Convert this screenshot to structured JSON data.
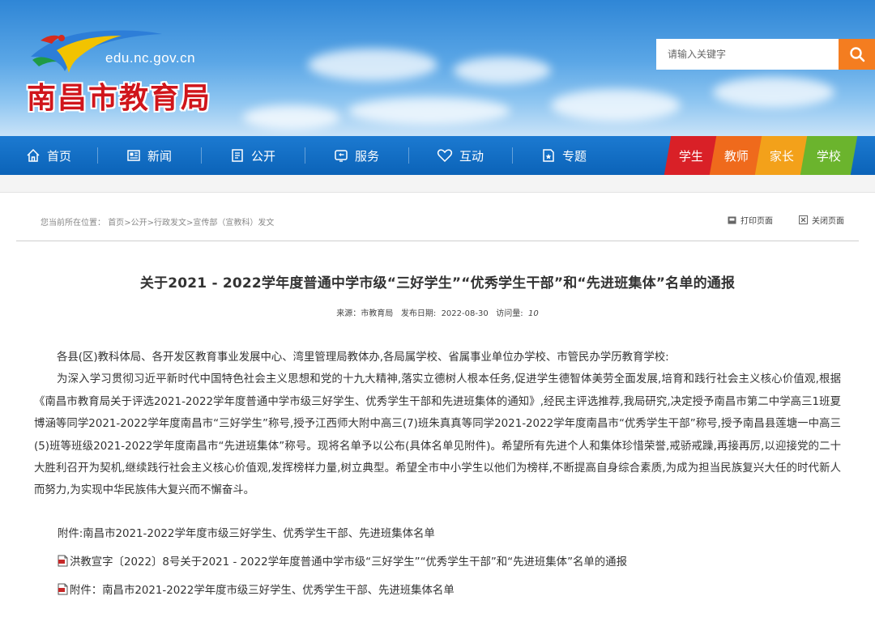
{
  "header": {
    "domain": "edu.nc.gov.cn",
    "site_title": "南昌市教育局"
  },
  "search": {
    "placeholder": "请输入关键字",
    "icon": "search-icon"
  },
  "nav": {
    "items": [
      {
        "label": "首页",
        "icon": "home-icon"
      },
      {
        "label": "新闻",
        "icon": "news-icon"
      },
      {
        "label": "公开",
        "icon": "document-icon"
      },
      {
        "label": "服务",
        "icon": "service-icon"
      },
      {
        "label": "互动",
        "icon": "heart-icon"
      },
      {
        "label": "专题",
        "icon": "topic-icon"
      }
    ],
    "roles": [
      "学生",
      "教师",
      "家长",
      "学校"
    ]
  },
  "colors": {
    "nav_blue": "#0b63b8",
    "search_orange": "#f47d20",
    "role_student": "#d92027",
    "role_teacher": "#ef6a1c",
    "role_parent": "#f3a11a",
    "role_school": "#6bb42d",
    "title_red": "#d0151b"
  },
  "breadcrumb": {
    "prefix": "您当前所在位置：",
    "items": [
      "首页",
      "公开",
      "行政发文",
      "宣传部（宣教科）发文"
    ]
  },
  "tools": {
    "print": "打印页面",
    "close": "关闭页面"
  },
  "article": {
    "title": "关于2021 - 2022学年度普通中学市级“三好学生”“优秀学生干部”和“先进班集体”名单的通报",
    "source_label": "来源：",
    "source": "市教育局",
    "date_label": "发布日期:",
    "date": "2022-08-30",
    "views_label": "访问量:",
    "views": "10",
    "paragraphs": [
      "各县(区)教科体局、各开发区教育事业发展中心、湾里管理局教体办,各局属学校、省属事业单位办学校、市管民办学历教育学校:",
      "为深入学习贯彻习近平新时代中国特色社会主义思想和党的十九大精神,落实立德树人根本任务,促进学生德智体美劳全面发展,培育和践行社会主义核心价值观,根据《南昌市教育局关于评选2021-2022学年度普通中学市级三好学生、优秀学生干部和先进班集体的通知》,经民主评选推荐,我局研究,决定授予南昌市第二中学高三1班夏博涵等同学2021-2022学年度南昌市“三好学生”称号,授予江西师大附中高三(7)班朱真真等同学2021-2022学年度南昌市“优秀学生干部”称号,授予南昌县莲塘一中高三(5)班等班级2021-2022学年度南昌市“先进班集体”称号。现将名单予以公布(具体名单见附件)。希望所有先进个人和集体珍惜荣誉,戒骄戒躁,再接再厉,以迎接党的二十大胜利召开为契机,继续践行社会主义核心价值观,发挥榜样力量,树立典型。希望全市中小学生以他们为榜样,不断提高自身综合素质,为成为担当民族复兴大任的时代新人而努力,为实现中华民族伟大复兴而不懈奋斗。"
    ],
    "attachment_note": "附件:南昌市2021-2022学年度市级三好学生、优秀学生干部、先进班集体名单",
    "attachments": [
      "洪教宣字〔2022〕8号关于2021 - 2022学年度普通中学市级“三好学生”“优秀学生干部”和“先进班集体”名单的通报",
      "附件：南昌市2021-2022学年度市级三好学生、优秀学生干部、先进班集体名单"
    ]
  }
}
